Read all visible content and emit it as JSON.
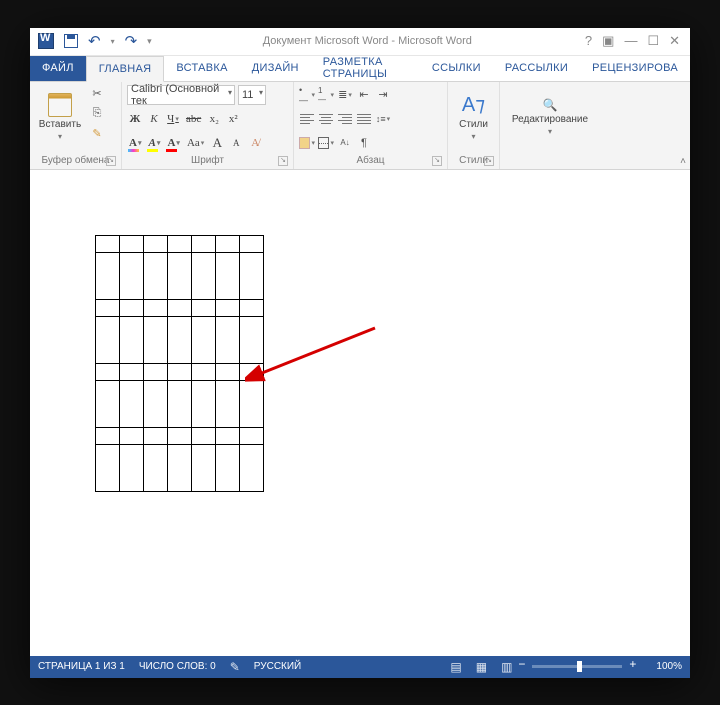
{
  "titlebar": {
    "title": "Документ Microsoft Word - Microsoft Word"
  },
  "tabs": {
    "file": "ФАЙЛ",
    "home": "ГЛАВНАЯ",
    "insert": "ВСТАВКА",
    "design": "ДИЗАЙН",
    "layout": "РАЗМЕТКА СТРАНИЦЫ",
    "refs": "ССЫЛКИ",
    "mail": "РАССЫЛКИ",
    "review": "РЕЦЕНЗИРОВА"
  },
  "ribbon": {
    "clipboard": {
      "paste": "Вставить",
      "group": "Буфер обмена"
    },
    "font": {
      "name": "Calibri (Основной тек",
      "size": "11",
      "group": "Шрифт",
      "bold": "Ж",
      "italic": "К",
      "underline": "Ч",
      "strike": "abc",
      "sub": "x₂",
      "sup": "x²",
      "case": "Aa",
      "clear": "A",
      "incr": "A",
      "decr": "A",
      "highlight": "A",
      "color": "A",
      "effects": "A"
    },
    "paragraph": {
      "group": "Абзац"
    },
    "styles": {
      "label": "Стили",
      "group": "Стили"
    },
    "editing": {
      "label": "Редактирование"
    }
  },
  "statusbar": {
    "page": "СТРАНИЦА 1 ИЗ 1",
    "words": "ЧИСЛО СЛОВ: 0",
    "lang": "РУССКИЙ",
    "zoom": "100%"
  }
}
